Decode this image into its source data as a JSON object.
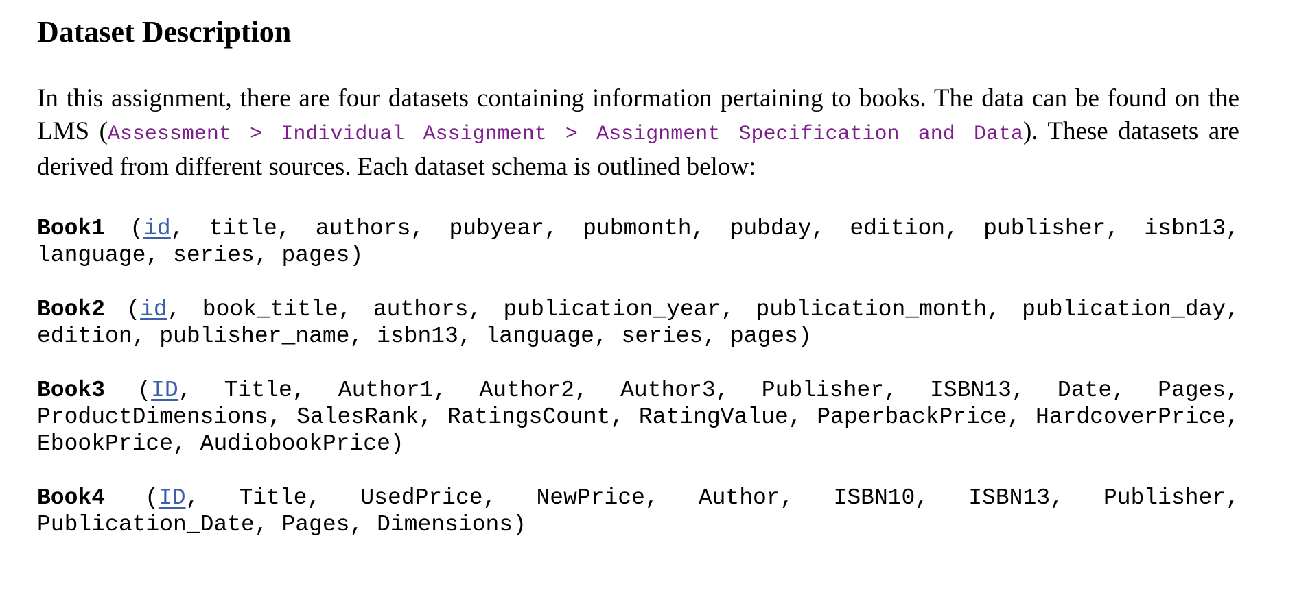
{
  "heading": "Dataset Description",
  "intro": {
    "text_before": "In this assignment, there are four datasets containing information pertaining to books. The data can be found on the LMS (",
    "lms_path": "Assessment > Individual Assignment > Assignment Specification and Data",
    "text_after": "). These datasets are derived from different sources. Each dataset schema is outlined below:"
  },
  "schemas": [
    {
      "name": "Book1",
      "key": "id",
      "fields": ", title, authors, pubyear, pubmonth, pubday, edition, publisher, isbn13, language, series, pages)"
    },
    {
      "name": "Book2",
      "key": "id",
      "fields": ", book_title, authors, publication_year, publication_month, publication_day, edition, publisher_name, isbn13, language, series, pages)"
    },
    {
      "name": "Book3",
      "key": "ID",
      "fields": ", Title, Author1, Author2, Author3, Publisher, ISBN13, Date, Pages, ProductDimensions, SalesRank, RatingsCount, RatingValue, PaperbackPrice, HardcoverPrice, EbookPrice, AudiobookPrice)"
    },
    {
      "name": "Book4",
      "key": "ID",
      "fields": ", Title, UsedPrice, NewPrice, Author, ISBN10, ISBN13, Publisher, Publication_Date, Pages, Dimensions)"
    }
  ],
  "colors": {
    "path": "#7b1f8a",
    "key_link": "#3b5fa8"
  }
}
